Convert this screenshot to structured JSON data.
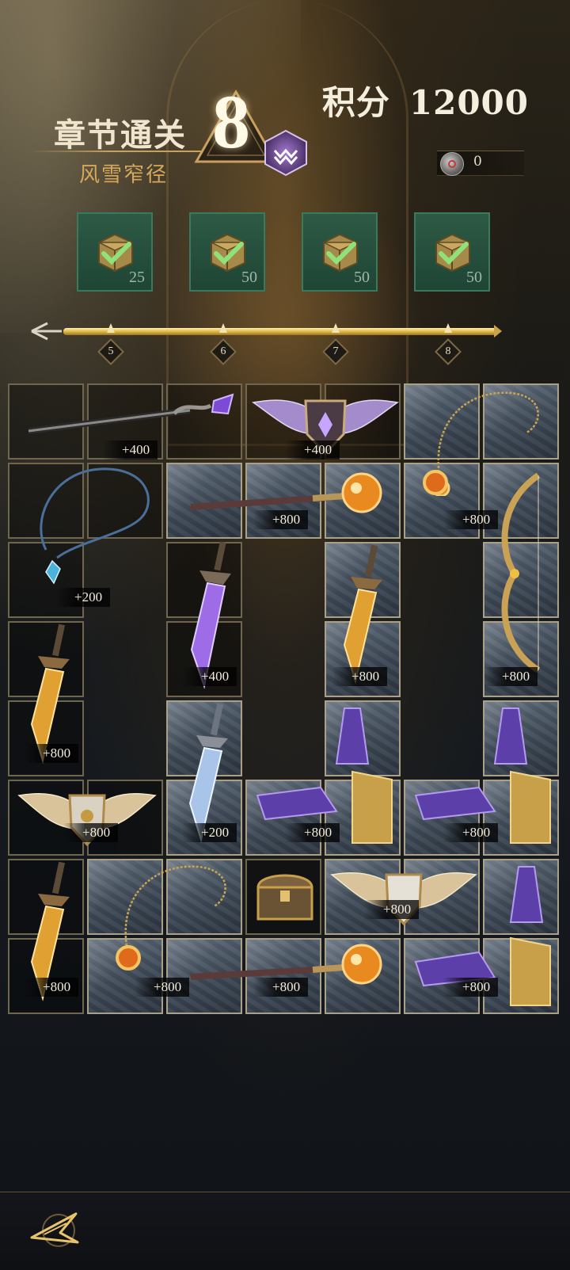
{
  "header": {
    "title": "章节通关",
    "subtitle": "风雪窄径",
    "chapter_number": "8",
    "score_label": "积分",
    "score_value": "12000",
    "token_count": "0"
  },
  "chests": [
    {
      "value": "25",
      "claimed": true
    },
    {
      "value": "50",
      "claimed": true
    },
    {
      "value": "50",
      "claimed": true
    },
    {
      "value": "50",
      "claimed": true
    }
  ],
  "milestones": [
    "5",
    "6",
    "7",
    "8"
  ],
  "grid_items": [
    {
      "name": "staff",
      "value": "+400"
    },
    {
      "name": "winged-shield-purple",
      "value": "+400"
    },
    {
      "name": "amulet-gold-top",
      "value": ""
    },
    {
      "name": "necklace-blue",
      "value": "+200"
    },
    {
      "name": "orb-scepter-top",
      "value": "+800"
    },
    {
      "name": "amulet-gold",
      "value": "+800"
    },
    {
      "name": "bow",
      "value": "+800"
    },
    {
      "name": "dagger-purple",
      "value": "+400"
    },
    {
      "name": "dagger-gold-col5",
      "value": "+800"
    },
    {
      "name": "dagger-gold-left",
      "value": "+800"
    },
    {
      "name": "dagger-ice",
      "value": "+200"
    },
    {
      "name": "gauntlet-col5",
      "value": "+800"
    },
    {
      "name": "gauntlet-col7",
      "value": "+800"
    },
    {
      "name": "winged-shield-gold",
      "value": "+800"
    },
    {
      "name": "treasure-chest",
      "value": ""
    },
    {
      "name": "winged-shield-white",
      "value": "+800"
    },
    {
      "name": "gauntlet-bottom-right",
      "value": "+800"
    },
    {
      "name": "dagger-gold-bottom-left",
      "value": "+800"
    },
    {
      "name": "amulet-sun",
      "value": "+800"
    },
    {
      "name": "orb-scepter-bottom",
      "value": "+800"
    }
  ],
  "colors": {
    "gold": "#d7a85c",
    "chest_green": "#2d5a45",
    "check_green": "#8fe27a"
  }
}
